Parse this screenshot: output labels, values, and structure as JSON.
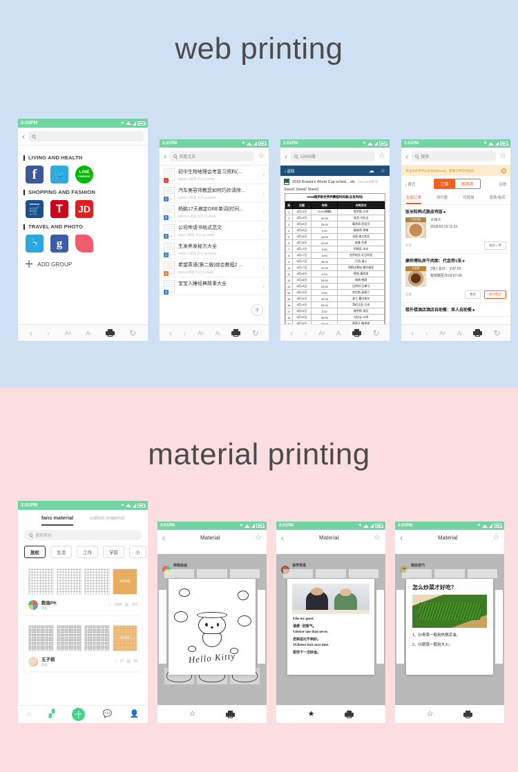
{
  "sections": {
    "web": {
      "title": "web printing",
      "bg": "#cfe0f4"
    },
    "material": {
      "title": "material printing",
      "bg": "#fcdee1"
    }
  },
  "status": {
    "time": "3:01PM",
    "bluetooth": "bluetooth-icon",
    "wifi": "wifi-icon",
    "signal": "signal-icon",
    "battery": "battery-icon"
  },
  "toolbar": {
    "back": "‹",
    "forward": "›",
    "font_increase": "A+",
    "font_decrease": "A-",
    "print": "printer-icon",
    "refresh": "↻"
  },
  "phone_bookmarks": {
    "search_placeholder": "",
    "groups": [
      {
        "title": "LIVING AND HEALTH",
        "apps": [
          "Facebook",
          "Twitter",
          "LINE FRIENDS"
        ]
      },
      {
        "title": "SHOPPING AND FASHION",
        "apps": [
          "amazon",
          "T",
          "JD"
        ]
      },
      {
        "title": "TRAVEL AND PHOTO",
        "apps": [
          "Ctrip",
          "Google",
          "Meitu"
        ]
      }
    ],
    "add_group": "ADD GROUP"
  },
  "phone_docs": {
    "url": "百度文库",
    "items": [
      {
        "title": "初中生物地理会考复习资料(...",
        "meta": "55033人阅读 大小:2.07MB",
        "badge": "A",
        "badge_color": "red"
      },
      {
        "title": "汽车美容师教您如何巧妙清除...",
        "meta": "12529人阅读 大小:13.00KB",
        "badge": "百",
        "badge_color": "blue"
      },
      {
        "title": "杨鹏17天搞定GRE单词(时间...",
        "meta": "68374人阅读 大小:70.00KB",
        "badge": "百",
        "badge_color": "blue"
      },
      {
        "title": "公司申请书格式范文",
        "meta": "4854人阅读 大小:31.00KB",
        "badge": "百",
        "badge_color": "blue"
      },
      {
        "title": "生发养发秘方大全",
        "meta": "70037人阅读 大小:36.00KB",
        "badge": "百",
        "badge_color": "blue"
      },
      {
        "title": "希望英语(第二版)综合教程2 ...",
        "meta": "5236人阅读 大小:4.16MB",
        "badge": "W",
        "badge_color": "orange"
      },
      {
        "title": "宝宝入睡经典故事大全",
        "meta": "",
        "badge": "百",
        "badge_color": "blue"
      }
    ],
    "scroll_top": "不"
  },
  "phone_excel": {
    "url": "13985路",
    "viewer_back": "返回",
    "viewer_download": "cloud-download-icon",
    "viewer_star": "star-icon",
    "file_name": "2018 Russia's World Cup sched....xls",
    "file_meta": "(26.01KB)昨天",
    "sheets": "Sheet1  Sheet2  Sheet3",
    "table_caption": "2018俄罗斯世界杯赛程时间表(北京时间)",
    "columns": [
      "场",
      "日期",
      "时间",
      "对阵双方"
    ],
    "rows": [
      [
        "1",
        "6月14日",
        "23:00(揭幕)",
        "俄罗斯-沙特"
      ],
      [
        "2",
        "6月15日",
        "20:00",
        "埃及-乌拉圭"
      ],
      [
        "3",
        "6月15日",
        "23:00",
        "摩洛哥-西班牙"
      ],
      [
        "4",
        "6月16日",
        "2:00",
        "摩洛哥-伊朗"
      ],
      [
        "5",
        "6月16日",
        "18:00",
        "法国-澳大利亚"
      ],
      [
        "6",
        "6月16日",
        "21:00",
        "秘鲁-丹麦"
      ],
      [
        "7",
        "6月17日",
        "0:00",
        "阿根廷-冰岛"
      ],
      [
        "8",
        "6月17日",
        "3:00",
        "克罗地亚-尼日利亚"
      ],
      [
        "9",
        "6月17日",
        "18:00",
        "巴西-瑞士"
      ],
      [
        "10",
        "6月17日",
        "21:00",
        "哥斯达黎加-塞尔维亚"
      ],
      [
        "11",
        "6月18日",
        "0:00",
        "德国-墨西哥"
      ],
      [
        "12",
        "6月18日",
        "20:00",
        "瑞典-韩国"
      ],
      [
        "13",
        "6月18日",
        "23:00",
        "比利时-巴拿马"
      ],
      [
        "14",
        "6月19日",
        "2:00",
        "突尼斯-英格兰"
      ],
      [
        "15",
        "6月19日",
        "20:00",
        "波兰-塞内加尔"
      ],
      [
        "16",
        "6月19日",
        "23:00",
        "哥伦比亚-日本"
      ],
      [
        "17",
        "6月20日",
        "2:00",
        "俄罗斯-埃及"
      ],
      [
        "18",
        "6月20日",
        "20:00",
        "乌拉圭-沙特"
      ],
      [
        "19",
        "6月20日",
        "23:00",
        "葡萄牙-摩洛哥"
      ]
    ]
  },
  "phone_dianping": {
    "url": "搜索",
    "notice": "关注大众点评公众号(dphuan)，获取订单实时动态",
    "notice_close": "close-icon",
    "home_link": "首页",
    "segments": [
      {
        "label": "订单",
        "active": true
      },
      {
        "label": "抵用券",
        "active": false
      }
    ],
    "right_link": "注销",
    "tabs": [
      {
        "label": "全部订单",
        "active": true
      },
      {
        "label": "待付款",
        "active": false
      },
      {
        "label": "可使用",
        "active": false
      },
      {
        "label": "退款/售后",
        "active": false
      }
    ],
    "orders": [
      {
        "name": "饭米粒韩式脆皮鸡饭 ▸",
        "tag": "订单完成",
        "price": "￥58.6",
        "time": "2018-03-19 11:33",
        "source": "外卖",
        "buttons": [
          "再买一单"
        ]
      },
      {
        "name": "康师傅私房牛肉面：代金券1张 ▸",
        "tag": "代金券",
        "price": "2张 | 总价：￥87.00",
        "time": "有效期至2018-07-09",
        "source": "正餐",
        "buttons": [
          "更多",
          "再次购买"
        ]
      }
    ],
    "partial_row": "楼外楼酒店酒店自助餐：单人自助餐 ▸"
  },
  "phone_material_list": {
    "tabs": [
      {
        "label": "fans material",
        "active": true
      },
      {
        "label": "collect material",
        "active": false
      }
    ],
    "search_placeholder": "搜索素材",
    "chips": [
      {
        "label": "放松",
        "active": true
      },
      {
        "label": "生活",
        "active": false
      },
      {
        "label": "工作",
        "active": false
      },
      {
        "label": "学前",
        "active": false
      },
      {
        "label": "小",
        "active": false
      }
    ],
    "cards": [
      {
        "title": "数独PK",
        "category": "放松",
        "stars": "1434",
        "prints": "287",
        "more_label": "MORE"
      },
      {
        "title": "五子棋",
        "category": "放松",
        "stars": "27",
        "prints": "65",
        "more_label": "MORE"
      }
    ],
    "nav": [
      {
        "icon": "home-icon",
        "active": false
      },
      {
        "icon": "grid-icon",
        "active": true
      },
      {
        "icon": "plus-icon",
        "active": false
      },
      {
        "icon": "chat-icon",
        "active": false
      },
      {
        "icon": "profile-icon",
        "active": false
      }
    ]
  },
  "phone_detail_kitty": {
    "title": "Material",
    "star": "star-icon",
    "author": "简笔绘画",
    "author_sub": "放松",
    "art_text": "Hello Kitty",
    "footer": {
      "star": "☆",
      "print": "printer-icon"
    }
  },
  "phone_detail_english": {
    "title": "Material",
    "star": "star-icon",
    "author": "速学英语",
    "author_sub": "学习",
    "lines": [
      "8.Be my guest.",
      "请便 / 别客气。",
      "9.Better late than never.",
      "迟到总比不到好。",
      "10.Better luck next time.",
      "祝你下一次好运。"
    ],
    "footer": {
      "star": "★",
      "print": "printer-icon"
    }
  },
  "phone_detail_cooking": {
    "title": "Material",
    "star": "star-icon",
    "author": "厨房技巧",
    "author_sub": "生活",
    "sheet_title": "怎么炒菜才好吃？",
    "lines": [
      "1、炒青菜一般用热锅凉油。",
      "2、炒蔬菜一般用大火。"
    ],
    "footer": {
      "star": "☆",
      "print": "printer-icon"
    }
  }
}
